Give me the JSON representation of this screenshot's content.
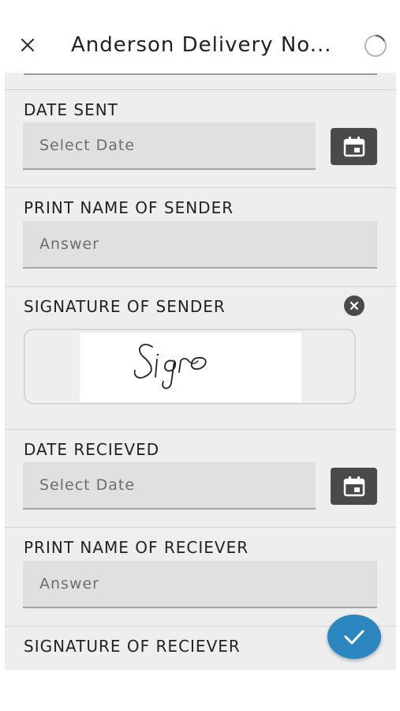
{
  "header": {
    "title": "Anderson Delivery No..."
  },
  "icons": {
    "close": "close-icon",
    "sync": "sync-icon",
    "calendar": "calendar-icon",
    "clear": "clear-icon",
    "check": "check-icon"
  },
  "colors": {
    "accent": "#2c86bf",
    "button_dark": "#4a4a4a",
    "field_bg": "#e0e0e0",
    "form_bg": "#eeeeee"
  },
  "form": {
    "date_sent": {
      "label": "DATE SENT",
      "placeholder": "Select Date"
    },
    "sender_name": {
      "label": "PRINT NAME OF SENDER",
      "placeholder": "Answer"
    },
    "sender_signature": {
      "label": "SIGNATURE OF SENDER",
      "signature_text": "Sigro"
    },
    "date_received": {
      "label": "DATE RECIEVED",
      "placeholder": "Select Date"
    },
    "receiver_name": {
      "label": "PRINT NAME OF RECIEVER",
      "placeholder": "Answer"
    },
    "receiver_signature": {
      "label": "SIGNATURE OF RECIEVER"
    }
  }
}
